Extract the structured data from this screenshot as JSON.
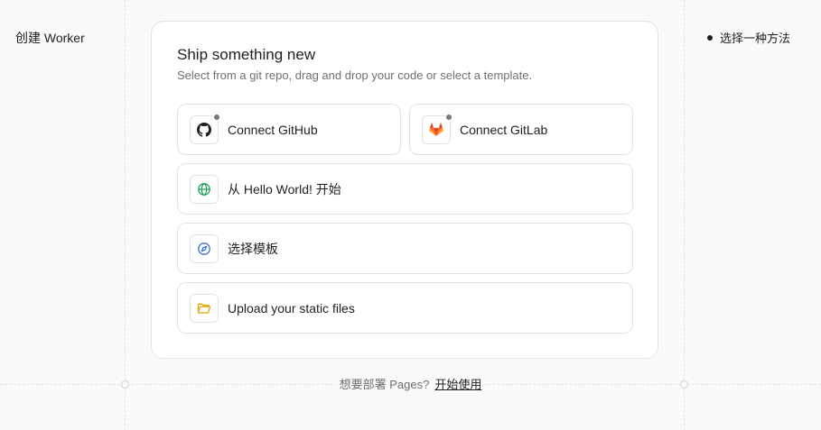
{
  "page": {
    "title": "创建 Worker"
  },
  "steps": [
    {
      "label": "选择一种方法"
    }
  ],
  "card": {
    "title": "Ship something new",
    "subtitle": "Select from a git repo, drag and drop your code or select a template."
  },
  "options": {
    "github": {
      "label": "Connect GitHub",
      "icon": "github-icon"
    },
    "gitlab": {
      "label": "Connect GitLab",
      "icon": "gitlab-icon"
    },
    "hello_world": {
      "label": "从 Hello World! 开始",
      "icon": "globe-icon"
    },
    "template": {
      "label": "选择模板",
      "icon": "compass-icon"
    },
    "upload": {
      "label": "Upload your static files",
      "icon": "folder-icon"
    }
  },
  "footer": {
    "text": "想要部署 Pages?",
    "link": "开始使用"
  },
  "colors": {
    "gitlab": "#e24329",
    "globe": "#22a35a",
    "compass": "#3b6fe0",
    "folder": "#e5a50a",
    "status_dot": "#7a7a7a"
  }
}
